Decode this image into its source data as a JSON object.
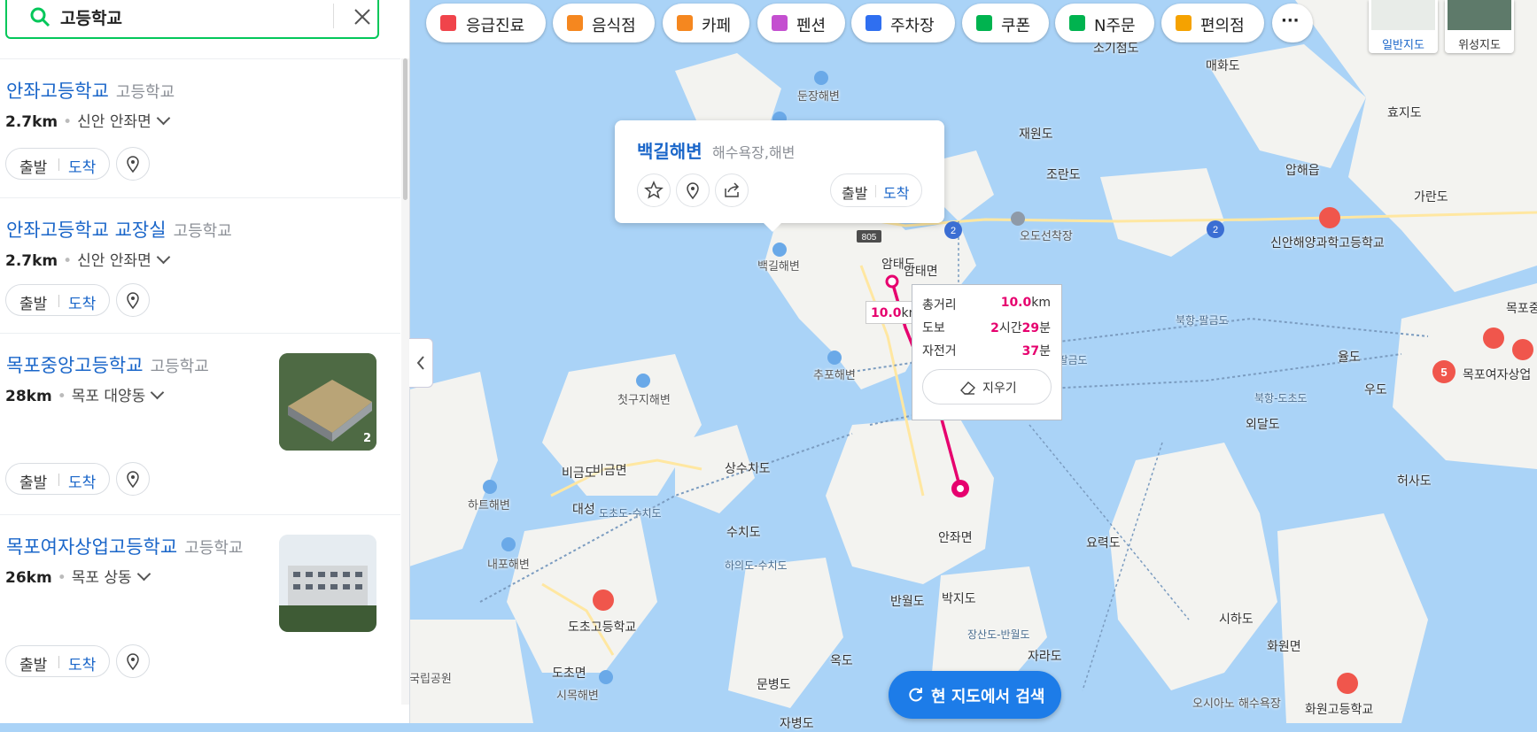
{
  "search": {
    "query": "고등학교"
  },
  "results": [
    {
      "name": "안좌고등학교",
      "category": "고등학교",
      "distance": "2.7km",
      "address": "신안 안좌면",
      "start": "출발",
      "arrive": "도착"
    },
    {
      "name": "안좌고등학교 교장실",
      "category": "고등학교",
      "distance": "2.7km",
      "address": "신안 안좌면",
      "start": "출발",
      "arrive": "도착"
    },
    {
      "name": "목포중앙고등학교",
      "category": "고등학교",
      "distance": "28km",
      "address": "목포 대양동",
      "start": "출발",
      "arrive": "도착",
      "photo_count": "2"
    },
    {
      "name": "목포여자상업고등학교",
      "category": "고등학교",
      "distance": "26km",
      "address": "목포 상동",
      "start": "출발",
      "arrive": "도착"
    }
  ],
  "chips": [
    {
      "label": "응급진료",
      "icon": "emergency-icon",
      "color": "#f0444b"
    },
    {
      "label": "음식점",
      "icon": "restaurant-icon",
      "color": "#f5871f"
    },
    {
      "label": "카페",
      "icon": "cafe-icon",
      "color": "#f5871f"
    },
    {
      "label": "펜션",
      "icon": "bed-icon",
      "color": "#c44fd0"
    },
    {
      "label": "주차장",
      "icon": "parking-icon",
      "color": "#2f6ff0"
    },
    {
      "label": "쿠폰",
      "icon": "coupon-icon",
      "color": "#00b34f"
    },
    {
      "label": "N주문",
      "icon": "order-icon",
      "color": "#00b34f"
    },
    {
      "label": "편의점",
      "icon": "store-icon",
      "color": "#f5a200"
    }
  ],
  "more_label": "···",
  "maptypes": {
    "normal": "일반지도",
    "satellite": "위성지도"
  },
  "popup": {
    "name": "백길해변",
    "category": "해수욕장,해변",
    "start": "출발",
    "arrive": "도착"
  },
  "measure": {
    "total_label": "총거리",
    "total_value": "10.0",
    "total_unit": "km",
    "walk_label": "도보",
    "walk_h": "2",
    "walk_h_unit": "시간",
    "walk_m": "29",
    "walk_m_unit": "분",
    "bike_label": "자전거",
    "bike_m": "37",
    "bike_unit": "분",
    "erase_label": "지우기",
    "tag_value": "10.0",
    "tag_unit": "km"
  },
  "research_label": "현 지도에서 검색",
  "map_labels": {
    "l1": "소기점도",
    "l2": "매화도",
    "l3": "둔장해변",
    "l4": "재원도",
    "l5": "효지도",
    "l6": "조란도",
    "l7": "압해읍",
    "l8": "가란도",
    "l9": "오도선착장",
    "l10": "신안해양과학고등학교",
    "l11": "백길해변",
    "l12": "암태도",
    "l13": "암태면",
    "l14": "목포중",
    "l15": "율도",
    "l16": "목포여자상업",
    "l17": "추포해변",
    "l18": "우도",
    "l19": "첫구지해변",
    "l20": "외달도",
    "l21": "비금도",
    "l22": "비금면",
    "l23": "상수치도",
    "l24": "허사도",
    "l25": "하트해변",
    "l26": "대성",
    "l27": "도초도-수치도",
    "l28": "수치도",
    "l29": "안좌면",
    "l30": "요력도",
    "l31": "내포해변",
    "l32": "하의도-수치도",
    "l33": "도초고등학교",
    "l34": "반월도",
    "l35": "박지도",
    "l36": "시하도",
    "l37": "화원면",
    "l38": "도초면",
    "l39": "국립공원",
    "l40": "옥도",
    "l41": "자라도",
    "l42": "시목해변",
    "l43": "문병도",
    "l44": "화원고등학교",
    "l45": "자병도",
    "l46": "오시아노 해수욕장",
    "road1": "805",
    "road2": "2",
    "road3": "2",
    "sea1": "북항-팔금도",
    "sea2": "목포항-팔금도",
    "sea3": "북항-도초도",
    "sea4": "장산도-반월도"
  },
  "cluster_count": "5"
}
